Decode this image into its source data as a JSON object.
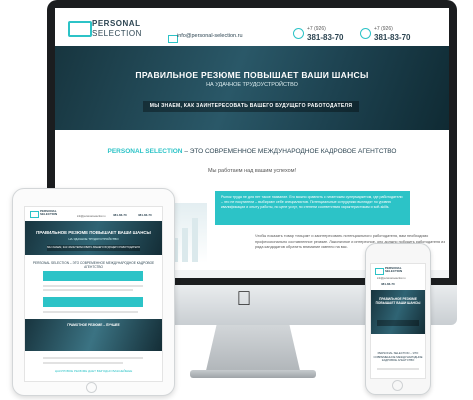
{
  "brand": {
    "name_line1": "PERSONAL",
    "name_line2": "SELECTION"
  },
  "header": {
    "email": "info@personal-selection.ru",
    "phones": [
      {
        "prefix": "+7 (926)",
        "number": "381-83-70"
      },
      {
        "prefix": "+7 (926)",
        "number": "381-83-70"
      }
    ]
  },
  "hero": {
    "title": "ПРАВИЛЬНОЕ РЕЗЮМЕ ПОВЫШАЕТ ВАШИ ШАНСЫ",
    "subtitle": "НА УДАЧНОЕ ТРУДОУСТРОЙСТВО",
    "banner": "МЫ ЗНАЕМ, КАК ЗАИНТЕРЕСОВАТЬ ВАШЕГО БУДУЩЕГО РАБОТОДАТЕЛЯ"
  },
  "section": {
    "title_accent": "PERSONAL SELECTION",
    "title_rest": " – ЭТО СОВРЕМЕННОЕ МЕЖДУНАРОДНОЕ КАДРОВОЕ АГЕНТСТВО",
    "subtitle": "Мы работаем над вашим успехом!",
    "box_text": "Рынок труда не для нет такое название. Его можно сравнить с гигантским супермаркетом, где работодатели – это не покупатели – выбирают себе специалистов. Потенциальные сотрудники выглядят по уровню квалификации и опыту работы, по цене услуг, по степени соответствия характеристикам и soft-skills.",
    "paragraph": "Чтобы показать товар «лицом» и заинтересовать потенциального работодателя, вам необходимо профессионально составленное резюме. Лаконичное и интересное, оно должно побудить работодателя из ряда кандидатов обратить внимание именно на вас."
  },
  "tablet": {
    "section_title": "PERSONAL SELECTION – ЭТО СОВРЕМЕННОЕ МЕЖДУНАРОДНОЕ КАДРОВОЕ АГЕНТСТВО",
    "hero2": "ГРАМОТНОЕ РЕЗЮМЕ – ЛУЧШЕЕ",
    "footer": "ЦАКУРОВОЕ РЕЗЮМЕ ДАЕТ ВЫГОДНО ВАЖНЕЙШЕЕ"
  },
  "phone": {
    "section_title": "PERSONAL SELECTION – ЭТО СОВРЕМЕННОЕ МЕЖДУНАРОДНОЕ КАДРОВОЕ АГЕНТСТВО"
  },
  "colors": {
    "accent": "#2cc3c7",
    "dark": "#2d4552",
    "hero": "#1d4250"
  }
}
